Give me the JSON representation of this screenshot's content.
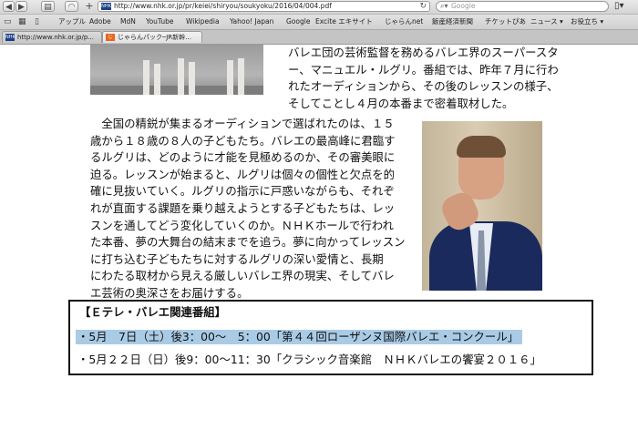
{
  "browser": {
    "url": "http://www.nhk.or.jp/pr/keiei/shiryou/soukyoku/2016/04/004.pdf",
    "url_favicon": "NHK",
    "search_placeholder": "Google",
    "bookmarks": [
      "アップル",
      "Adobe",
      "MdN",
      "YouTube",
      "Wikipedia",
      "Yahoo! Japan",
      "Google",
      "Excite エキサイト",
      "じゃらんnet",
      "飯産経済新聞",
      "チケットぴあ",
      "ニュース ▾",
      "お役立ち ▾"
    ],
    "tabs": [
      {
        "label": "http://www.nhk.or.jp/p...",
        "favicon": "NHK"
      },
      {
        "label": "じゃらんパック─JR新幹…",
        "favicon": "じ"
      }
    ]
  },
  "article": {
    "intro_lines": [
      "バレエ団の芸術監督を務めるバレエ界のスーパースタ",
      "ー、マニュエル・ルグリ。番組では、昨年７月に行わ",
      "れたオーディションから、その後のレッスンの様子、",
      "そしてことし４月の本番まで密着取材した。"
    ],
    "body_lines": [
      "　全国の精鋭が集まるオーディションで選ばれたのは、１５",
      "歳から１８歳の８人の子どもたち。バレエの最高峰に君臨す",
      "るルグリは、どのように才能を見極めるのか、その審美眼に",
      "迫る。レッスンが始まると、ルグリは個々の個性と欠点を的",
      "確に見抜いていく。ルグリの指示に戸惑いながらも、それぞ",
      "れが直面する課題を乗り越えようとする子どもたちは、レッ",
      "スンを通してどう変化していくのか。ＮＨＫホールで行われ",
      "た本番、夢の大舞台の結末までを追う。夢に向かってレッスン",
      "に打ち込む子どもたちに対するルグリの深い愛情と、長期",
      "にわたる取材から見える厳しいバレエ界の現実、そしてバレ",
      "エ芸術の奥深さをお届けする。"
    ]
  },
  "program_box": {
    "title": "【Ｅテレ・バレエ関連番組】",
    "items": [
      "・5月　7日（土）後3：00～　5：00「第４４回ローザンヌ国際バレエ・コンクール」",
      "・5月２２日（日）後9：00～11：30「クラシック音楽館　ＮＨＫバレエの饗宴２０１６」"
    ],
    "highlight_color": "#a9cbe6"
  }
}
